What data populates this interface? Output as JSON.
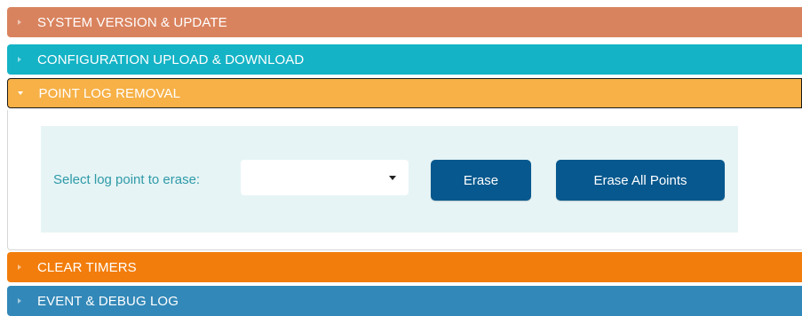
{
  "sections": [
    {
      "label": "SYSTEM VERSION & UPDATE",
      "color": "#d9835e",
      "expanded": false
    },
    {
      "label": "CONFIGURATION UPLOAD & DOWNLOAD",
      "color": "#14b3c6",
      "expanded": false
    },
    {
      "label": "POINT LOG REMOVAL",
      "color": "#f7b147",
      "expanded": true
    },
    {
      "label": "CLEAR TIMERS",
      "color": "#f27d0c",
      "expanded": false
    },
    {
      "label": "EVENT & DEBUG LOG",
      "color": "#3288b8",
      "expanded": false
    }
  ],
  "point_log_removal": {
    "select_label": "Select log point to erase:",
    "select_value": "",
    "erase_button": "Erase",
    "erase_all_button": "Erase All Points"
  },
  "icons": {
    "collapsed": "caret-right-icon",
    "expanded": "caret-down-icon",
    "dropdown": "dropdown-arrow-icon"
  }
}
